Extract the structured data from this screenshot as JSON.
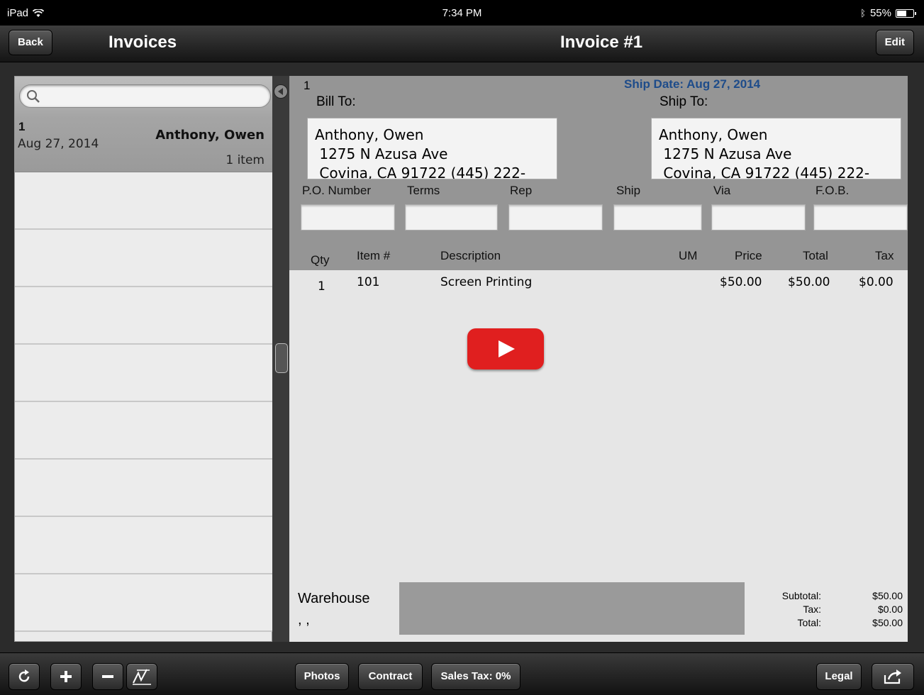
{
  "status_bar": {
    "device": "iPad",
    "time": "7:34 PM",
    "battery": "55%"
  },
  "nav": {
    "back_label": "Back",
    "list_title": "Invoices",
    "detail_title": "Invoice #1",
    "edit_label": "Edit"
  },
  "invoice_list": {
    "search_placeholder": "",
    "items": [
      {
        "number": "1",
        "date": "Aug 27, 2014",
        "customer": "Anthony, Owen",
        "count": "1 item"
      }
    ]
  },
  "invoice": {
    "number": "1",
    "ship_date": "Ship Date: Aug 27, 2014",
    "bill_to_label": "Bill To:",
    "ship_to_label": "Ship To:",
    "bill_to": [
      "Anthony, Owen",
      " 1275 N Azusa Ave",
      " Covina, CA 91722 (445) 222-"
    ],
    "ship_to": [
      "Anthony, Owen",
      " 1275 N Azusa Ave",
      " Covina, CA 91722 (445) 222-"
    ],
    "fields": {
      "po_number": "P.O. Number",
      "terms": "Terms",
      "rep": "Rep",
      "ship": "Ship",
      "via": "Via",
      "fob": "F.O.B."
    },
    "columns": {
      "qty": "Qty",
      "item": "Item #",
      "description": "Description",
      "um": "UM",
      "price": "Price",
      "total": "Total",
      "tax": "Tax"
    },
    "lines": [
      {
        "qty": "1",
        "item": "101",
        "description": "Screen Printing",
        "um": "",
        "price": "$50.00",
        "total": "$50.00",
        "tax": "$0.00"
      }
    ],
    "warehouse_label": "Warehouse",
    "warehouse_value": ", ,",
    "totals": {
      "subtotal_label": "Subtotal:",
      "subtotal": "$50.00",
      "tax_label": "Tax:",
      "tax": "$0.00",
      "total_label": "Total:",
      "total": "$50.00"
    }
  },
  "toolbar": {
    "photos": "Photos",
    "contract": "Contract",
    "sales_tax": "Sales Tax: 0%",
    "legal": "Legal"
  }
}
